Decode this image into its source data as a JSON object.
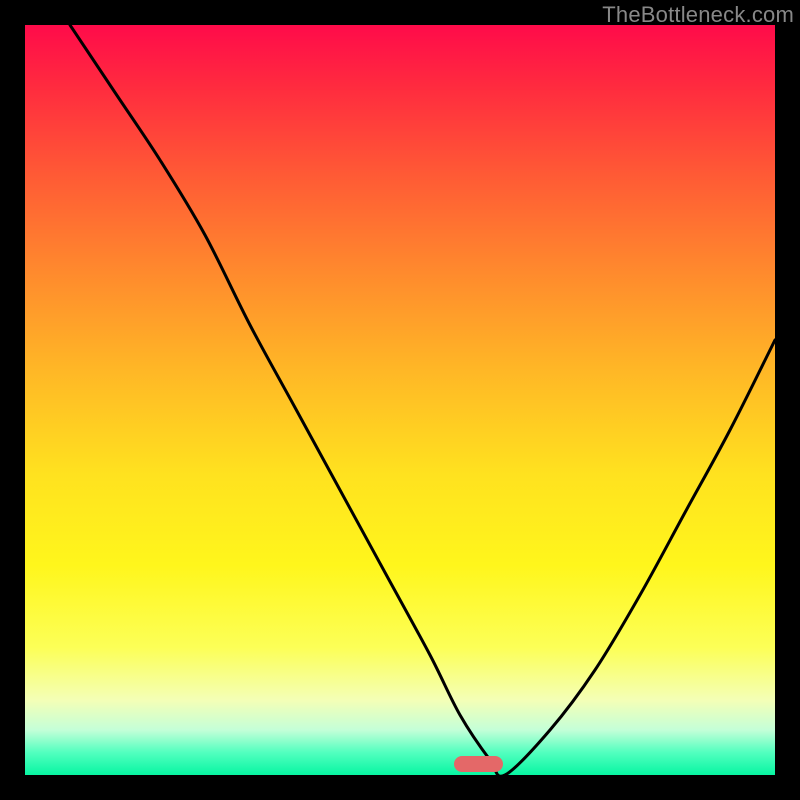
{
  "watermark": "TheBottleneck.com",
  "chart_data": {
    "type": "line",
    "title": "",
    "xlabel": "",
    "ylabel": "",
    "xlim": [
      0,
      100
    ],
    "ylim": [
      0,
      100
    ],
    "grid": false,
    "legend": false,
    "series": [
      {
        "name": "bottleneck-curve",
        "x": [
          6,
          12,
          18,
          24,
          30,
          36,
          42,
          48,
          54,
          58,
          62,
          64,
          70,
          76,
          82,
          88,
          94,
          100
        ],
        "y": [
          100,
          91,
          82,
          72,
          60,
          49,
          38,
          27,
          16,
          8,
          2,
          0,
          6,
          14,
          24,
          35,
          46,
          58
        ]
      }
    ],
    "marker": {
      "x_pct": 60.5,
      "y_pct": 98.5,
      "width_pct": 6.5,
      "height_pct": 2.2,
      "color": "#e46868"
    },
    "gradient_stops": [
      {
        "pos": 0,
        "color": "#ff0b4a"
      },
      {
        "pos": 50,
        "color": "#ffc523"
      },
      {
        "pos": 100,
        "color": "#07f6a2"
      }
    ]
  }
}
